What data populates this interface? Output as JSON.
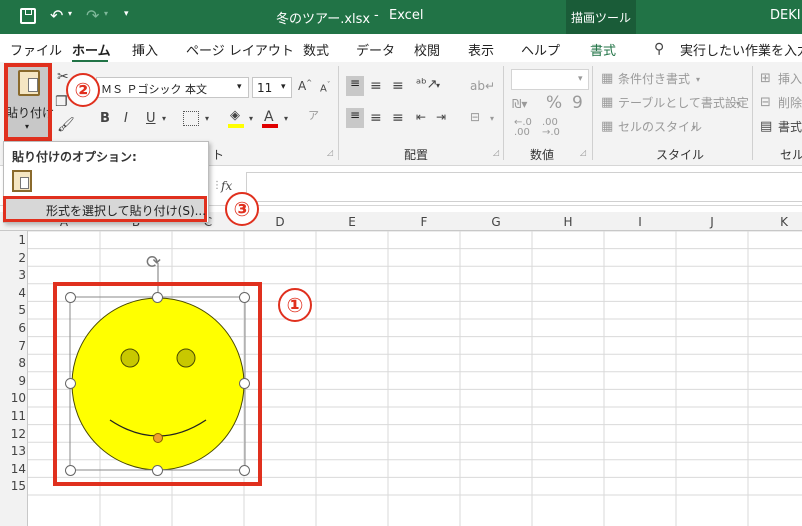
{
  "titlebar": {
    "undo_icon": "undo-icon",
    "redo_icon": "redo-icon",
    "file_name": "冬のツアー.xlsx",
    "separator": "-",
    "app_name": "Excel",
    "context_tab": "描画ツール",
    "user": "DEKI"
  },
  "tabs": {
    "file": "ファイル",
    "home": "ホーム",
    "insert": "挿入",
    "page_layout": "ページ レイアウト",
    "formulas": "数式",
    "data": "データ",
    "review": "校閲",
    "view": "表示",
    "help": "ヘルプ",
    "format": "書式",
    "tell_me": "実行したい作業を入力し"
  },
  "ribbon": {
    "paste_label": "貼り付け",
    "font_name": "ＭＳ Ｐゴシック 本文",
    "font_size": "11",
    "bold": "B",
    "italic": "I",
    "underline": "U",
    "font_color_letter": "A",
    "alignment_group": "配置",
    "number_group": "数値",
    "style_group": "スタイル",
    "cells_group": "セル",
    "font_group_tail": "ト",
    "conditional_format": "条件付き書式",
    "format_as_table": "テーブルとして書式設定",
    "cell_styles": "セルのスタイル",
    "insert_cells": "挿入",
    "delete_cells": "削除",
    "format_cells": "書式",
    "percent": "%",
    "comma": "9",
    "fx": "fx"
  },
  "paste_menu": {
    "title": "貼り付けのオプション:",
    "special": "形式を選択して貼り付け(S)..."
  },
  "badges": {
    "one": "①",
    "two": "②",
    "three": "③"
  },
  "grid": {
    "columns": [
      "A",
      "B",
      "C",
      "D",
      "E",
      "F",
      "G",
      "H",
      "I",
      "J",
      "K"
    ],
    "rows": [
      "1",
      "2",
      "3",
      "4",
      "5",
      "6",
      "7",
      "8",
      "9",
      "10",
      "11",
      "12",
      "13",
      "14",
      "15"
    ]
  },
  "colors": {
    "excel_green": "#217346",
    "highlight_red": "#e0301e",
    "smiley_fill": "#ffff00",
    "eye_fill": "#c8c800",
    "font_color_bar": "#e00000",
    "highlight_bar": "#ffff00"
  }
}
